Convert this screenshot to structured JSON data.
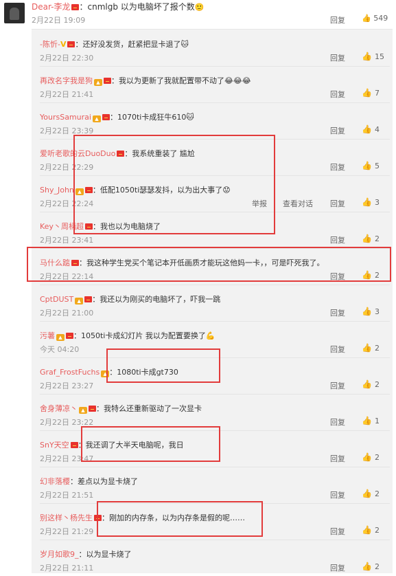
{
  "top_comment": {
    "user": "Dear-李龙",
    "text": "：cnmlgb 以为电脑坏了报个数",
    "emoji": "🙂",
    "time": "2月22日 19:09",
    "reply": "回复",
    "likes": "549"
  },
  "replies": [
    {
      "user": "-陈忻-",
      "text": "：还好没发货，赶紧把显卡退了",
      "emoji": "🐱",
      "time": "2月22日 22:30",
      "reply": "回复",
      "likes": "15"
    },
    {
      "user": "再改名字我是狗",
      "text": "：我以为更新了我就配置带不动了",
      "emoji": "😂😂😂",
      "time": "2月22日 21:41",
      "reply": "回复",
      "likes": "7"
    },
    {
      "user": "YoursSamurai",
      "text": "：1070ti卡成狂牛610",
      "emoji": "🐱",
      "time": "2月22日 23:39",
      "reply": "回复",
      "likes": "4"
    },
    {
      "user": "爱听老歌的云DuoDuo",
      "text": "：我系统重装了 尴尬",
      "emoji": "",
      "time": "2月22日 22:29",
      "reply": "回复",
      "likes": "5"
    },
    {
      "user": "Shy_John",
      "text": "：低配1050ti瑟瑟发抖，以为出大事了",
      "emoji": "😟",
      "time": "2月22日 22:24",
      "report": "举报",
      "view_chat": "查看对话",
      "reply": "回复",
      "likes": "3"
    },
    {
      "user": "Key丶周柄超",
      "text": "：我也以为电脑烧了",
      "emoji": "",
      "time": "2月22日 23:41",
      "reply": "回复",
      "likes": "2"
    },
    {
      "user": "马什么踮",
      "text": "：我这种学生党买个笔记本开低画质才能玩这他妈一卡，，可是吓死我了。",
      "emoji": "",
      "time": "2月22日 22:14",
      "reply": "回复",
      "likes": "2"
    },
    {
      "user": "CptDUST",
      "text": "：我还以为刚买的电脑坏了，吓我一跳",
      "emoji": "",
      "time": "2月22日 21:00",
      "reply": "回复",
      "likes": "3"
    },
    {
      "user": "污薯",
      "text": "：1050ti卡成幻灯片 我以为配置要换了",
      "emoji": "💪",
      "time": "今天 04:20",
      "reply": "回复",
      "likes": "2"
    },
    {
      "user": "Graf_FrostFuchs",
      "text": "：1080ti卡成gt730",
      "emoji": "",
      "time": "2月22日 23:27",
      "reply": "回复",
      "likes": "2"
    },
    {
      "user": "舍身薄凉丶",
      "text": "：我特么还重新驱动了一次显卡",
      "emoji": "",
      "time": "2月22日 23:22",
      "reply": "回复",
      "likes": "1"
    },
    {
      "user": "SnY天空",
      "text": "：我还调了大半天电脑呢，我日",
      "emoji": "",
      "time": "2月22日 23:47",
      "reply": "回复",
      "likes": "2"
    },
    {
      "user": "幻非落樱",
      "text": "：差点以为显卡烧了",
      "emoji": "",
      "time": "2月22日 21:51",
      "reply": "回复",
      "likes": "2"
    },
    {
      "user": "别这样丶杨先生",
      "text": "：刚加的内存条，以为内存条是假的呢……",
      "emoji": "",
      "time": "2月22日 21:29",
      "reply": "回复",
      "likes": "2"
    },
    {
      "user": "岁月如歌9_",
      "text": "：以为显卡烧了",
      "emoji": "",
      "time": "2月22日 21:11",
      "reply": "回复",
      "likes": "2"
    }
  ],
  "icons": {
    "like": "thumbs-up-icon",
    "red_badge": "red-envelope-badge-icon",
    "gold_badge": "member-badge-icon"
  },
  "colors": {
    "username": "#e75c5c",
    "annotation": "#e23b3b",
    "panel": "#f2f2f2"
  }
}
